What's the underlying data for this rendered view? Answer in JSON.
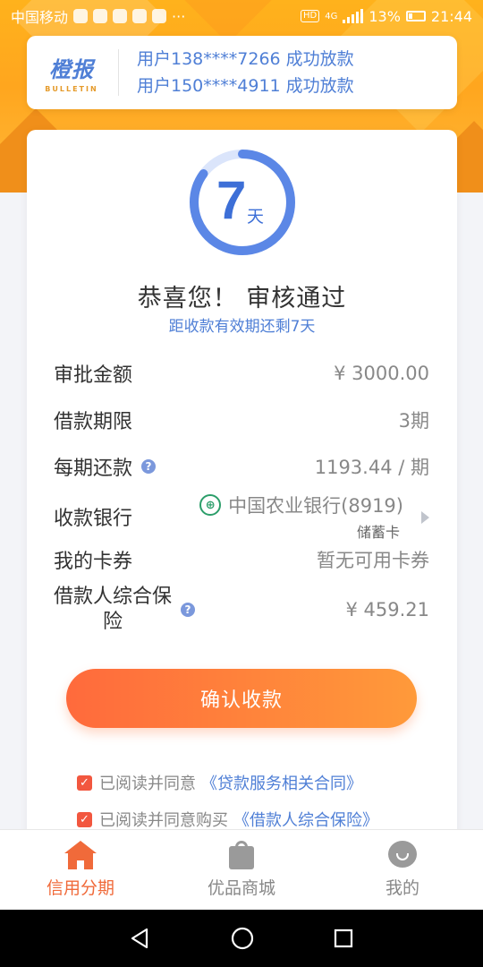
{
  "status_bar": {
    "carrier": "中国移动",
    "hd": "HD",
    "network": "4G",
    "battery": "13%",
    "time": "21:44",
    "more": "···"
  },
  "bulletin": {
    "logo_main": "橙报",
    "logo_sub": "BULLETIN",
    "messages": [
      "用户138****7266 成功放款",
      "用户150****4911 成功放款"
    ]
  },
  "countdown": {
    "number": "7",
    "unit": "天",
    "remaining_fraction": 0.85,
    "ring_color": "#5b87e6"
  },
  "result": {
    "title": "恭喜您！ 审核通过",
    "subtitle": "距收款有效期还剩7天"
  },
  "details": {
    "amount_label": "审批金额",
    "amount_value": "¥ 3000.00",
    "term_label": "借款期限",
    "term_value": "3期",
    "installment_label": "每期还款",
    "installment_value": "1193.44 / 期",
    "bank_label": "收款银行",
    "bank_name": "中国农业银行(8919)",
    "bank_card_type": "储蓄卡",
    "coupon_label": "我的卡券",
    "coupon_value": "暂无可用卡券",
    "insurance_label_line1": "借款人综合保",
    "insurance_label_line2": "险",
    "insurance_value": "¥ 459.21"
  },
  "actions": {
    "confirm_label": "确认收款"
  },
  "agreements": [
    {
      "text": "已阅读并同意",
      "link": "《贷款服务相关合同》",
      "checked": true
    },
    {
      "text": "已阅读并同意购买",
      "link": "《借款人综合保险》",
      "checked": true
    }
  ],
  "tabbar": {
    "tabs": [
      {
        "label": "信用分期",
        "icon": "home-icon",
        "active": true
      },
      {
        "label": "优品商城",
        "icon": "shopping-bag-icon",
        "active": false
      },
      {
        "label": "我的",
        "icon": "user-icon",
        "active": false
      }
    ]
  },
  "colors": {
    "accent_orange": "#f06a3a",
    "link_blue": "#4f7fd6",
    "banner_orange": "#ffa61e"
  }
}
